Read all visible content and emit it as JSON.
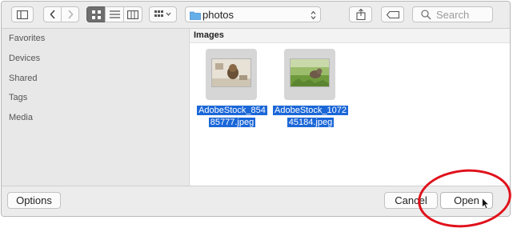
{
  "toolbar": {
    "path_label": "photos",
    "search_placeholder": "Search",
    "icons": [
      "sidebar-toggle-icon",
      "back-arrow-icon",
      "forward-arrow-icon",
      "icon-view-icon",
      "list-view-icon",
      "column-view-icon",
      "group-by-icon",
      "folder-icon",
      "updown-chevron-icon",
      "share-icon",
      "tag-icon",
      "search-icon"
    ]
  },
  "sidebar": {
    "items": [
      {
        "label": "Favorites"
      },
      {
        "label": "Devices"
      },
      {
        "label": "Shared"
      },
      {
        "label": "Tags"
      },
      {
        "label": "Media"
      }
    ]
  },
  "main": {
    "section_title": "Images",
    "files": [
      {
        "name_line1": "AdobeStock_854",
        "name_line2": "85777.jpeg",
        "selected": true
      },
      {
        "name_line1": "AdobeStock_1072",
        "name_line2": "45184.jpeg",
        "selected": true
      }
    ]
  },
  "bottom": {
    "options_label": "Options",
    "cancel_label": "Cancel",
    "open_label": "Open"
  },
  "colors": {
    "selection": "#1b67d8",
    "annotation_circle": "#e0111b"
  }
}
